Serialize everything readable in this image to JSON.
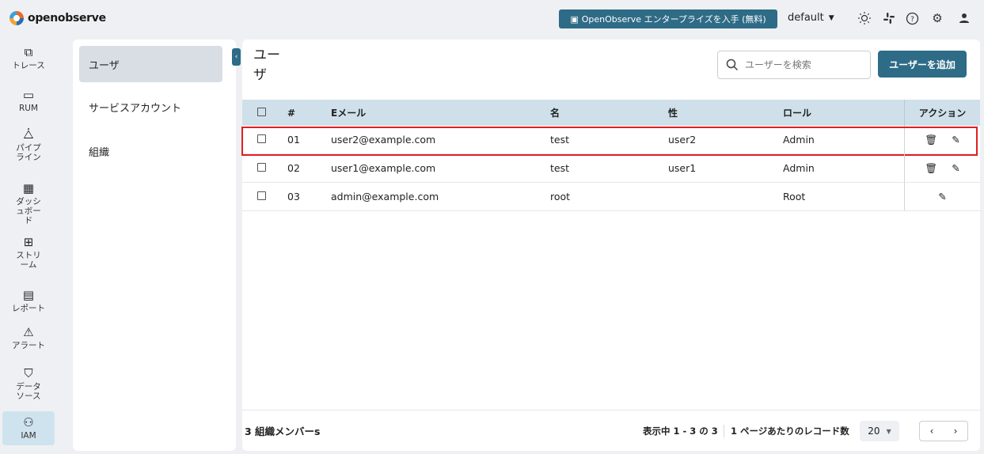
{
  "app": {
    "logo_text": "openobserve"
  },
  "header": {
    "enterprise_button": "OpenObserve エンタープライズを入手 (無料)",
    "org_selected": "default",
    "icons": [
      "theme-icon",
      "slack-icon",
      "help-icon",
      "settings-icon",
      "user-icon"
    ]
  },
  "nav": {
    "items": [
      {
        "label": "トレース",
        "icon": "traces-icon"
      },
      {
        "label": "RUM",
        "icon": "rum-icon"
      },
      {
        "label": "パイプライン",
        "icon": "pipeline-icon"
      },
      {
        "label": "ダッシュボード",
        "icon": "dashboard-icon"
      },
      {
        "label": "ストリーム",
        "icon": "streams-icon"
      },
      {
        "label": "レポート",
        "icon": "report-icon"
      },
      {
        "label": "アラート",
        "icon": "alert-icon"
      },
      {
        "label": "データソース",
        "icon": "datasource-icon"
      },
      {
        "label": "IAM",
        "icon": "iam-icon"
      }
    ]
  },
  "subnav": {
    "items": [
      {
        "label": "ユーザ"
      },
      {
        "label": "サービスアカウント"
      },
      {
        "label": "組織"
      }
    ]
  },
  "main": {
    "title": "ユーザ",
    "search_placeholder": "ユーザーを検索",
    "add_button": "ユーザーを追加"
  },
  "table": {
    "headers": {
      "num": "#",
      "email": "Eメール",
      "first": "名",
      "last": "性",
      "role": "ロール",
      "actions": "アクション"
    },
    "rows": [
      {
        "num": "01",
        "email": "user2@example.com",
        "first": "test",
        "last": "user2",
        "role": "Admin"
      },
      {
        "num": "02",
        "email": "user1@example.com",
        "first": "test",
        "last": "user1",
        "role": "Admin"
      },
      {
        "num": "03",
        "email": "admin@example.com",
        "first": "root",
        "last": "",
        "role": "Root"
      }
    ]
  },
  "footer": {
    "member_count": "3 組織メンバーs",
    "range_text": "表示中 1 - 3 の 3",
    "rows_per_page_label": "1 ページあたりのレコード数",
    "rows_per_page": "20"
  },
  "colors": {
    "accent": "#2e6b86",
    "header_bg": "#cfe0ea",
    "highlight": "#e02020"
  }
}
